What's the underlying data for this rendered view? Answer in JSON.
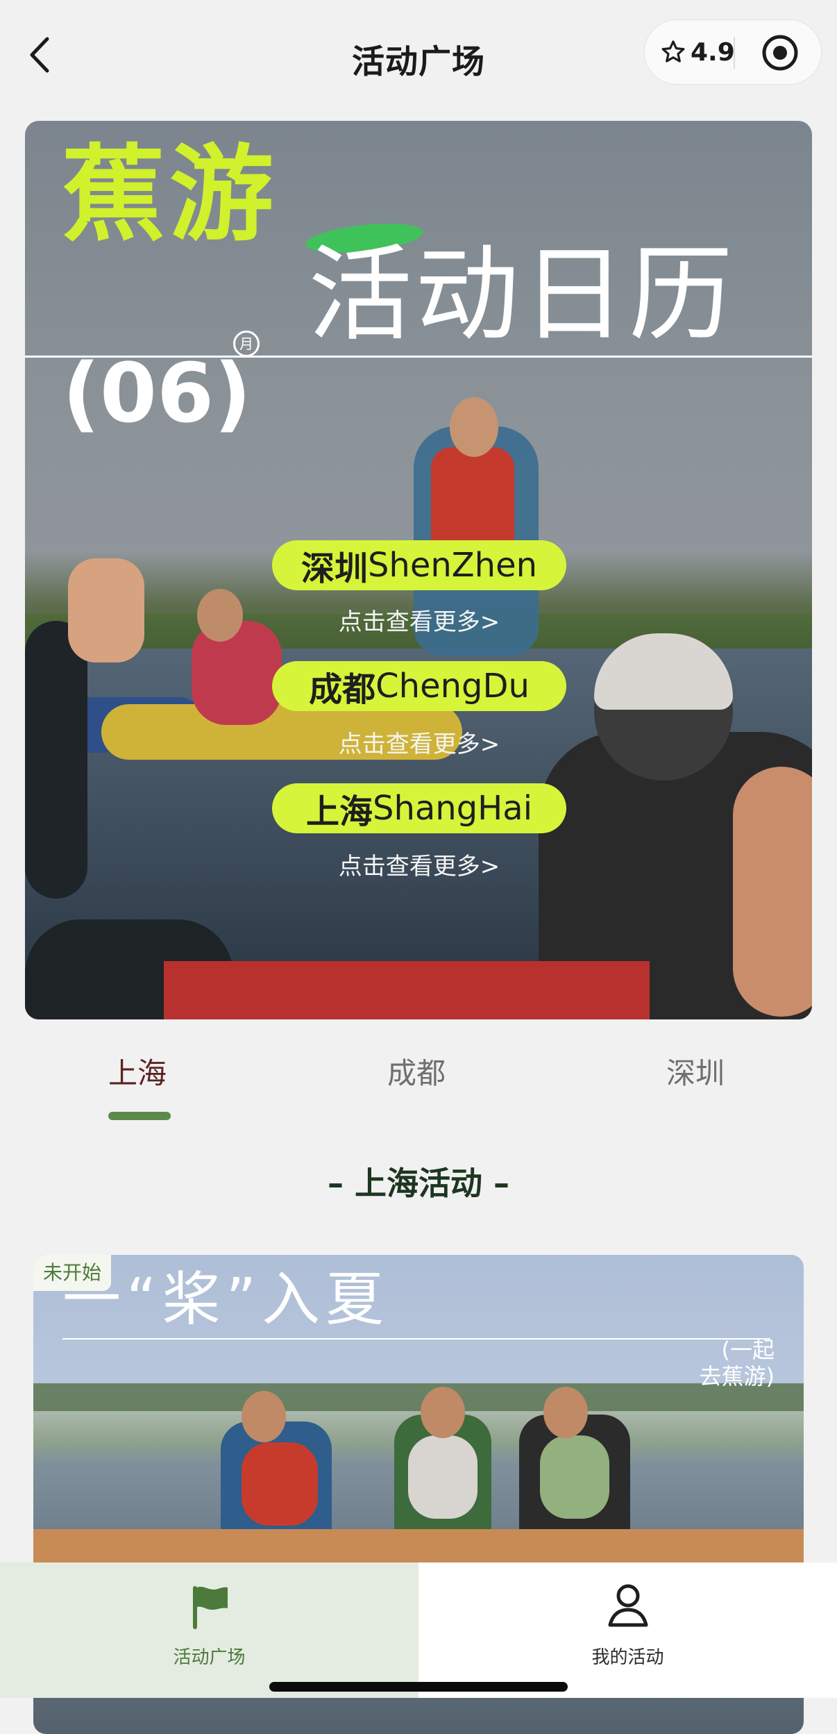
{
  "header": {
    "title": "活动广场",
    "back_icon": "chevron-left-icon",
    "rating": "4.9",
    "rating_icon": "star-outline-icon",
    "capsule_action_icon": "target-circle-icon"
  },
  "banner": {
    "brand": "蕉游",
    "title": "活动日历",
    "month_unit": "月",
    "month": "(06)",
    "cities": [
      {
        "cn": "深圳",
        "en": "ShenZhen",
        "more": "点击查看更多>"
      },
      {
        "cn": "成都",
        "en": "ChengDu",
        "more": "点击查看更多>"
      },
      {
        "cn": "上海",
        "en": "ShangHai",
        "more": "点击查看更多>"
      }
    ],
    "accent": "#d6f43a"
  },
  "tabs": {
    "items": [
      "上海",
      "成都",
      "深圳"
    ],
    "active_index": 0,
    "indicator_color": "#5c8a4a"
  },
  "section": {
    "title": "– 上海活动 –"
  },
  "activity_card": {
    "status": "未开始",
    "title": "一“桨”入夏",
    "subtitle_line1": "(一起",
    "subtitle_line2": "去蕉游)"
  },
  "bottom_nav": {
    "items": [
      {
        "label": "活动广场",
        "icon": "flag-icon",
        "active": true
      },
      {
        "label": "我的活动",
        "icon": "user-icon",
        "active": false
      }
    ],
    "active_color": "#4c7a3b"
  }
}
